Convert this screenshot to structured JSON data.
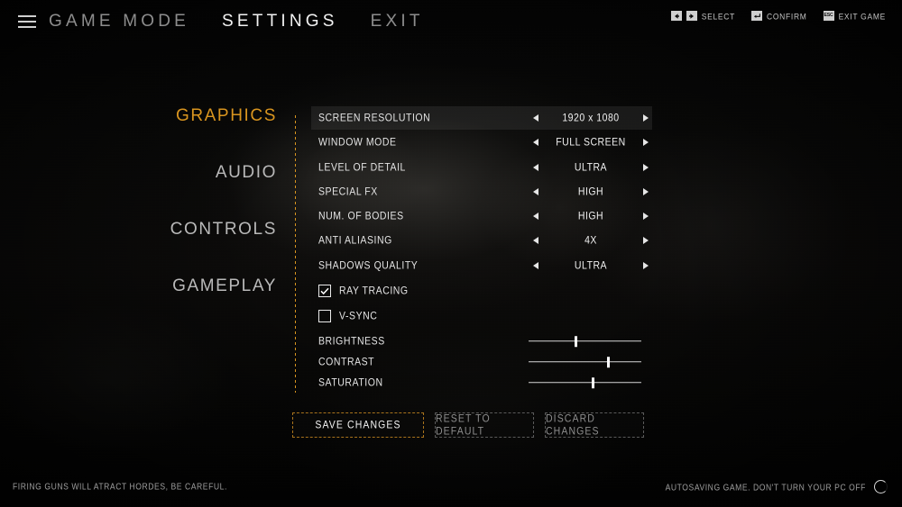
{
  "accent_color": "#d9951f",
  "topbar": {
    "menu_icon": "hamburger-icon",
    "items": [
      {
        "label": "GAME MODE",
        "active": false
      },
      {
        "label": "SETTINGS",
        "active": true
      },
      {
        "label": "EXIT",
        "active": false
      }
    ],
    "hints": [
      {
        "label": "SELECT",
        "keys": [
          "arrow-left-key",
          "arrow-right-key"
        ]
      },
      {
        "label": "CONFIRM",
        "keys": [
          "enter-key"
        ]
      },
      {
        "label": "EXIT GAME",
        "keys": [
          "esc-key"
        ]
      }
    ],
    "esc_cap": "ESC"
  },
  "sidebar": {
    "items": [
      {
        "label": "GRAPHICS",
        "active": true
      },
      {
        "label": "AUDIO",
        "active": false
      },
      {
        "label": "CONTROLS",
        "active": false
      },
      {
        "label": "GAMEPLAY",
        "active": false
      }
    ]
  },
  "settings": {
    "steppers": [
      {
        "label": "SCREEN RESOLUTION",
        "value": "1920 x 1080",
        "selected": true
      },
      {
        "label": "WINDOW MODE",
        "value": "FULL SCREEN",
        "selected": false
      },
      {
        "label": "LEVEL OF DETAIL",
        "value": "ULTRA",
        "selected": false
      },
      {
        "label": "SPECIAL FX",
        "value": "HIGH",
        "selected": false
      },
      {
        "label": "NUM. OF BODIES",
        "value": "HIGH",
        "selected": false
      },
      {
        "label": "ANTI ALIASING",
        "value": "4X",
        "selected": false
      },
      {
        "label": "SHADOWS QUALITY",
        "value": "ULTRA",
        "selected": false
      }
    ],
    "checkboxes": [
      {
        "label": "RAY TRACING",
        "checked": true
      },
      {
        "label": "V-SYNC",
        "checked": false
      }
    ],
    "sliders": [
      {
        "label": "BRIGHTNESS",
        "percent": 42
      },
      {
        "label": "CONTRAST",
        "percent": 71
      },
      {
        "label": "SATURATION",
        "percent": 57
      }
    ]
  },
  "buttons": [
    {
      "label": "SAVE CHANGES",
      "style": "primary"
    },
    {
      "label": "RESET TO DEFAULT",
      "style": "ghost"
    },
    {
      "label": "DISCARD CHANGES",
      "style": "ghost"
    }
  ],
  "footer": {
    "tip": "FIRING GUNS WILL ATRACT HORDES, BE CAREFUL.",
    "autosave": "AUTOSAVING GAME. DON'T TURN YOUR PC OFF",
    "spinner_icon": "loading-spinner-icon"
  }
}
